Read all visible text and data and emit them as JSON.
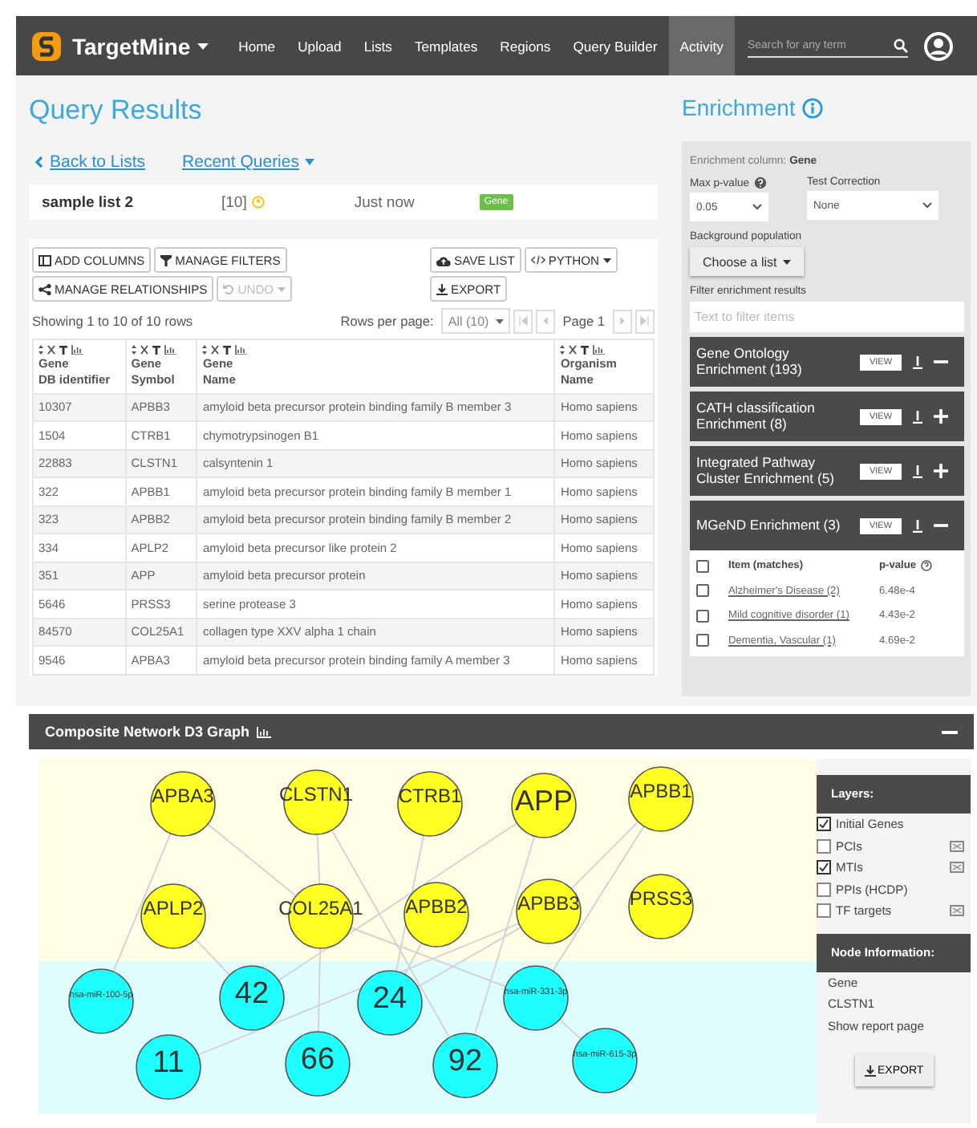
{
  "navbar": {
    "brand": "TargetMine",
    "items": [
      {
        "label": "Home",
        "selected": false
      },
      {
        "label": "Upload",
        "selected": false
      },
      {
        "label": "Lists",
        "selected": false
      },
      {
        "label": "Templates",
        "selected": false
      },
      {
        "label": "Regions",
        "selected": false
      },
      {
        "label": "Query Builder",
        "selected": false
      },
      {
        "label": "Activity",
        "selected": true
      }
    ],
    "search": {
      "placeholder": "Search for any term"
    }
  },
  "page": {
    "title": "Query Results",
    "links": [
      {
        "label": "Back to Lists",
        "kind": "back"
      },
      {
        "label": "Recent Queries",
        "kind": "menu"
      }
    ]
  },
  "list_info": {
    "name": "sample list 2",
    "count": "[10]",
    "time": "Just now",
    "tag": "Gene"
  },
  "toolbar": {
    "left": [
      {
        "label": "ADD COLUMNS",
        "kind": "columns",
        "dropdown": false,
        "disabled": false
      },
      {
        "label": "MANAGE FILTERS",
        "kind": "filter",
        "dropdown": false,
        "disabled": false
      },
      {
        "label": "MANAGE RELATIONSHIPS",
        "kind": "relations",
        "dropdown": false,
        "disabled": false
      },
      {
        "label": "UNDO",
        "kind": "undo",
        "dropdown": true,
        "disabled": true
      }
    ],
    "right": [
      {
        "label": "SAVE LIST",
        "kind": "save",
        "dropdown": false,
        "disabled": false
      },
      {
        "label": "PYTHON",
        "kind": "python",
        "dropdown": true,
        "disabled": false
      },
      {
        "label": "EXPORT",
        "kind": "export",
        "dropdown": false,
        "disabled": false
      }
    ]
  },
  "pager": {
    "showing": "Showing 1 to 10 of 10 rows",
    "rows_label": "Rows per page:",
    "rows_value": "All (10)",
    "page": "Page 1"
  },
  "table": {
    "columns": [
      "Gene\nDB identifier",
      "Gene\nSymbol",
      "Gene\nName",
      "Organism\nName"
    ],
    "rows": [
      [
        "10307",
        "APBB3",
        "amyloid beta precursor protein binding family B member 3",
        "Homo sapiens"
      ],
      [
        "1504",
        "CTRB1",
        "chymotrypsinogen B1",
        "Homo sapiens"
      ],
      [
        "22883",
        "CLSTN1",
        "calsyntenin 1",
        "Homo sapiens"
      ],
      [
        "322",
        "APBB1",
        "amyloid beta precursor protein binding family B member 1",
        "Homo sapiens"
      ],
      [
        "323",
        "APBB2",
        "amyloid beta precursor protein binding family B member 2",
        "Homo sapiens"
      ],
      [
        "334",
        "APLP2",
        "amyloid beta precursor like protein 2",
        "Homo sapiens"
      ],
      [
        "351",
        "APP",
        "amyloid beta precursor protein",
        "Homo sapiens"
      ],
      [
        "5646",
        "PRSS3",
        "serine protease 3",
        "Homo sapiens"
      ],
      [
        "84570",
        "COL25A1",
        "collagen type XXV alpha 1 chain",
        "Homo sapiens"
      ],
      [
        "9546",
        "APBA3",
        "amyloid beta precursor protein binding family A member 3",
        "Homo sapiens"
      ]
    ]
  },
  "enrichment": {
    "title": "Enrichment",
    "column_label": "Enrichment column:",
    "column_value": "Gene",
    "max_p_label": "Max p-value",
    "max_p": "0.05",
    "correction_label": "Test Correction",
    "correction": "None",
    "background_label": "Background population",
    "background_button": "Choose a list",
    "filter_label": "Filter enrichment results",
    "filter_placeholder": "Text to filter items",
    "sections": [
      {
        "title": "Gene Ontology Enrichment (193)",
        "view": "VIEW",
        "expanded": true
      },
      {
        "title": "CATH classification Enrichment (8)",
        "view": "VIEW",
        "expanded": false
      },
      {
        "title": "Integrated Pathway Cluster Enrichment (5)",
        "view": "VIEW",
        "expanded": false
      },
      {
        "title": "MGeND Enrichment (3)",
        "view": "VIEW",
        "expanded": true,
        "results": {
          "all_checked": false,
          "item_header": "Item (matches)",
          "p_header": "p-value",
          "rows": [
            {
              "item": "Alzheimer's Disease (2)",
              "p": "6.48e-4",
              "checked": false
            },
            {
              "item": "Mild cognitive disorder (1)",
              "p": "4.43e-2",
              "checked": false
            },
            {
              "item": "Dementia, Vascular (1)",
              "p": "4.69e-2",
              "checked": false
            }
          ]
        }
      }
    ]
  },
  "graph": {
    "title": "Composite Network D3 Graph",
    "nodes": [
      {
        "label": "APBA3",
        "kind": "gene"
      },
      {
        "label": "CLSTN1",
        "kind": "gene"
      },
      {
        "label": "CTRB1",
        "kind": "gene"
      },
      {
        "label": "APP",
        "kind": "gene"
      },
      {
        "label": "APBB1",
        "kind": "gene"
      },
      {
        "label": "APLP2",
        "kind": "gene"
      },
      {
        "label": "COL25A1",
        "kind": "gene"
      },
      {
        "label": "APBB2",
        "kind": "gene"
      },
      {
        "label": "APBB3",
        "kind": "gene"
      },
      {
        "label": "PRSS3",
        "kind": "gene"
      },
      {
        "label": "hsa-miR-100-5p",
        "kind": "mirna"
      },
      {
        "label": "42",
        "kind": "mirna"
      },
      {
        "label": "24",
        "kind": "mirna"
      },
      {
        "label": "hsa-miR-331-3p",
        "kind": "mirna"
      },
      {
        "label": "11",
        "kind": "mirna"
      },
      {
        "label": "66",
        "kind": "mirna"
      },
      {
        "label": "92",
        "kind": "mirna"
      },
      {
        "label": "hsa-miR-615-3p",
        "kind": "mirna"
      }
    ],
    "layers_title": "Layers:",
    "layers": [
      {
        "label": "Initial Genes",
        "checked": true,
        "legend": false
      },
      {
        "label": "PCIs",
        "checked": false,
        "legend": true
      },
      {
        "label": "MTIs",
        "checked": true,
        "legend": true
      },
      {
        "label": "PPIs (HCDP)",
        "checked": false,
        "legend": false
      },
      {
        "label": "TF targets",
        "checked": false,
        "legend": true
      }
    ],
    "node_info_title": "Node Information:",
    "node_info": [
      "Gene",
      "CLSTN1",
      "Show report page"
    ],
    "export": "EXPORT"
  }
}
